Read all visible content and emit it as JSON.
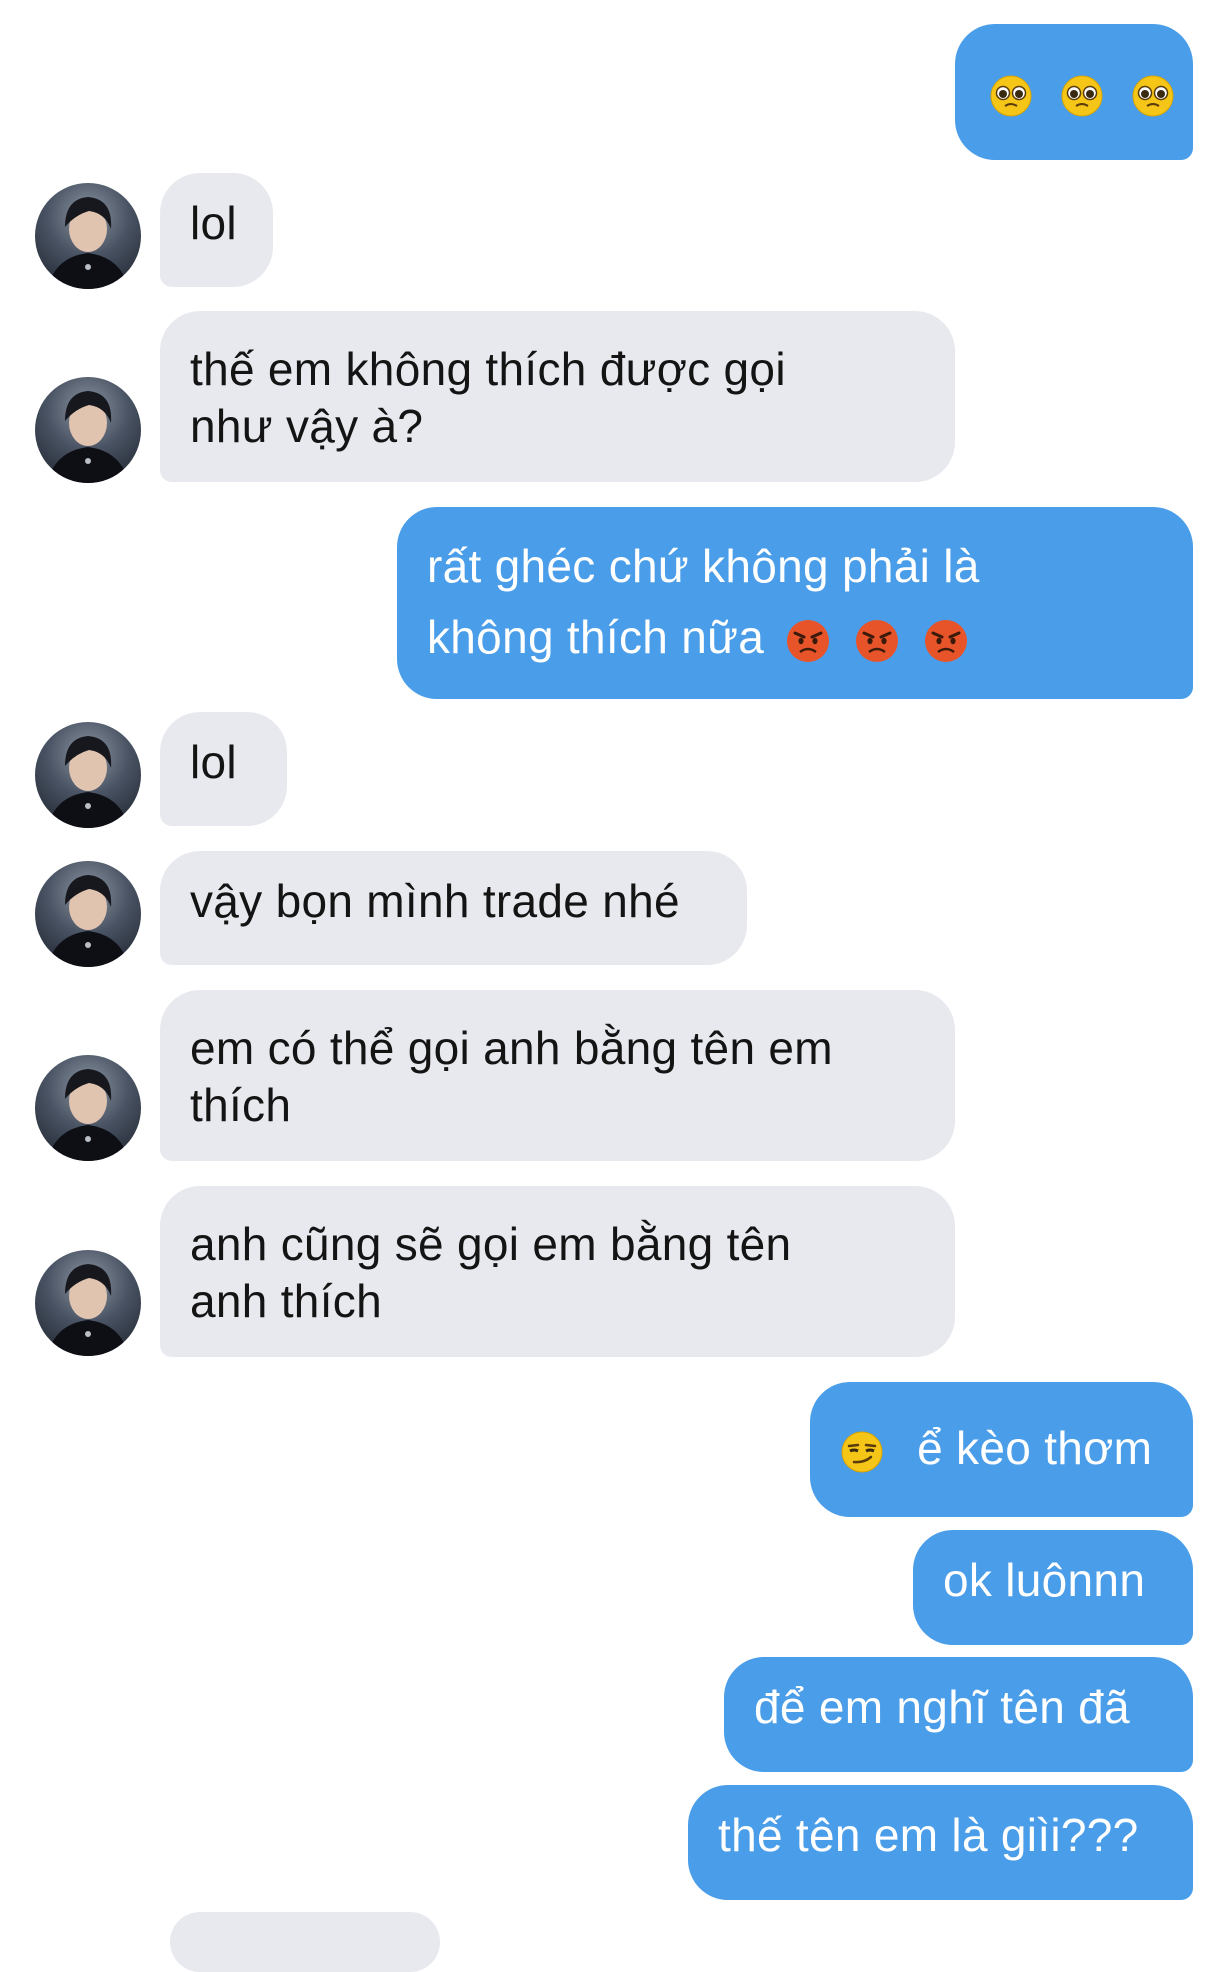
{
  "messages": [
    {
      "side": "out",
      "text": "🥺🥺🥺",
      "emoji": "pleading-face"
    },
    {
      "side": "in",
      "text": "lol"
    },
    {
      "side": "in",
      "text": "thế em không thích được gọi như vậy à?"
    },
    {
      "side": "out",
      "text": "rất ghéc chứ không phải là không thích nữa 😡😡😡",
      "emoji": "angry-face"
    },
    {
      "side": "in",
      "text": "lol"
    },
    {
      "side": "in",
      "text": "vậy bọn mình trade nhé"
    },
    {
      "side": "in",
      "text": "em có thể gọi anh bằng tên em thích"
    },
    {
      "side": "in",
      "text": "anh cũng sẽ gọi em bằng tên anh thích"
    },
    {
      "side": "out",
      "text": "😏 ể kèo thơm",
      "emoji": "smirk-face"
    },
    {
      "side": "out",
      "text": "ok luônnn"
    },
    {
      "side": "out",
      "text": "để em nghĩ tên đã"
    },
    {
      "side": "out",
      "text": "thế tên em là giìi???"
    }
  ],
  "colors": {
    "outgoing_bubble": "#4a9de8",
    "incoming_bubble": "#e7e9ee",
    "background": "#ffffff"
  }
}
